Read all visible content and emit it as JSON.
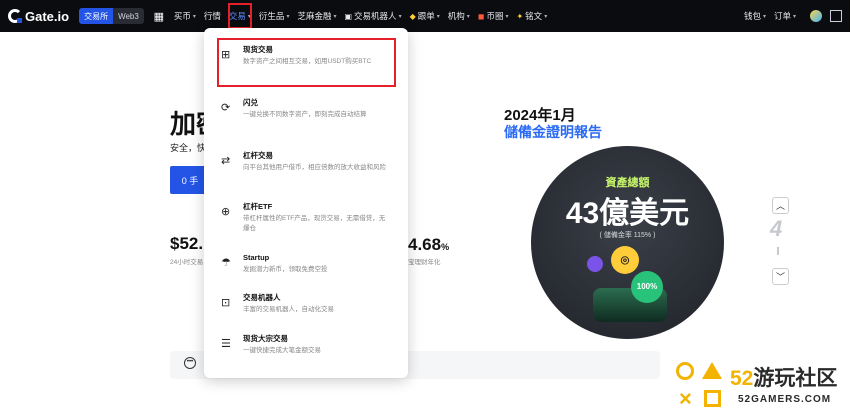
{
  "brand": {
    "name": "Gate.io"
  },
  "mode_switch": {
    "exchange": "交易所",
    "web3": "Web3"
  },
  "nav": {
    "items": [
      {
        "label": "买币",
        "caret": "▾"
      },
      {
        "label": "行情",
        "caret": ""
      },
      {
        "label": "交易",
        "caret": "▾"
      },
      {
        "label": "衍生品",
        "caret": "▾"
      },
      {
        "label": "芝麻金融",
        "caret": "▾"
      },
      {
        "label": "交易机器人",
        "caret": "▾"
      },
      {
        "label": "跟单",
        "caret": "▾"
      },
      {
        "label": "机构",
        "caret": "▾"
      },
      {
        "label": "币圈",
        "caret": "▾"
      },
      {
        "label": "铭文",
        "caret": "▾"
      }
    ],
    "wallet": "钱包",
    "orders": "订单"
  },
  "hero": {
    "title": "加密",
    "subtitle": "安全，快",
    "button": "0 手",
    "stat1_value": "$52.",
    "stat1_label": "24小时交易",
    "stat2_value": "4.68",
    "stat2_unit": "%",
    "stat2_label": "宝理财年化"
  },
  "trade_menu": {
    "items": [
      {
        "title": "现货交易",
        "desc": "数字资产之间相互交易，如用USDT购买BTC"
      },
      {
        "title": "闪兑",
        "desc": "一键兑换不同数字资产，即刻完成自动结算"
      },
      {
        "title": "杠杆交易",
        "desc": "向平台其他用户借币，相应倍数的放大收益和风险"
      },
      {
        "title": "杠杆ETF",
        "desc": "带杠杆属性的ETF产品，现货交易，无需借贷，无爆仓"
      },
      {
        "title": "Startup",
        "desc": "发掘潜力新币，领取免费空投"
      },
      {
        "title": "交易机器人",
        "desc": "丰富的交易机器人，自动化交易"
      },
      {
        "title": "现货大宗交易",
        "desc": "一键快捷完成大笔金额交易"
      }
    ]
  },
  "report": {
    "year": "2024年1月",
    "title": "儲備金證明報告",
    "label": "資產總額",
    "amount": "43億美元",
    "rate": "( 儲備金率 115% )",
    "coin_badge": "100%"
  },
  "side": {
    "number": "4"
  },
  "watermark": {
    "num": "52",
    "title": "游玩社区",
    "sub": "52GAMERS.COM"
  },
  "colors": {
    "accent": "#2354e6",
    "highlight": "#e6202a",
    "report_blue": "#2b6bf3",
    "watermark_yellow": "#f2b400"
  }
}
